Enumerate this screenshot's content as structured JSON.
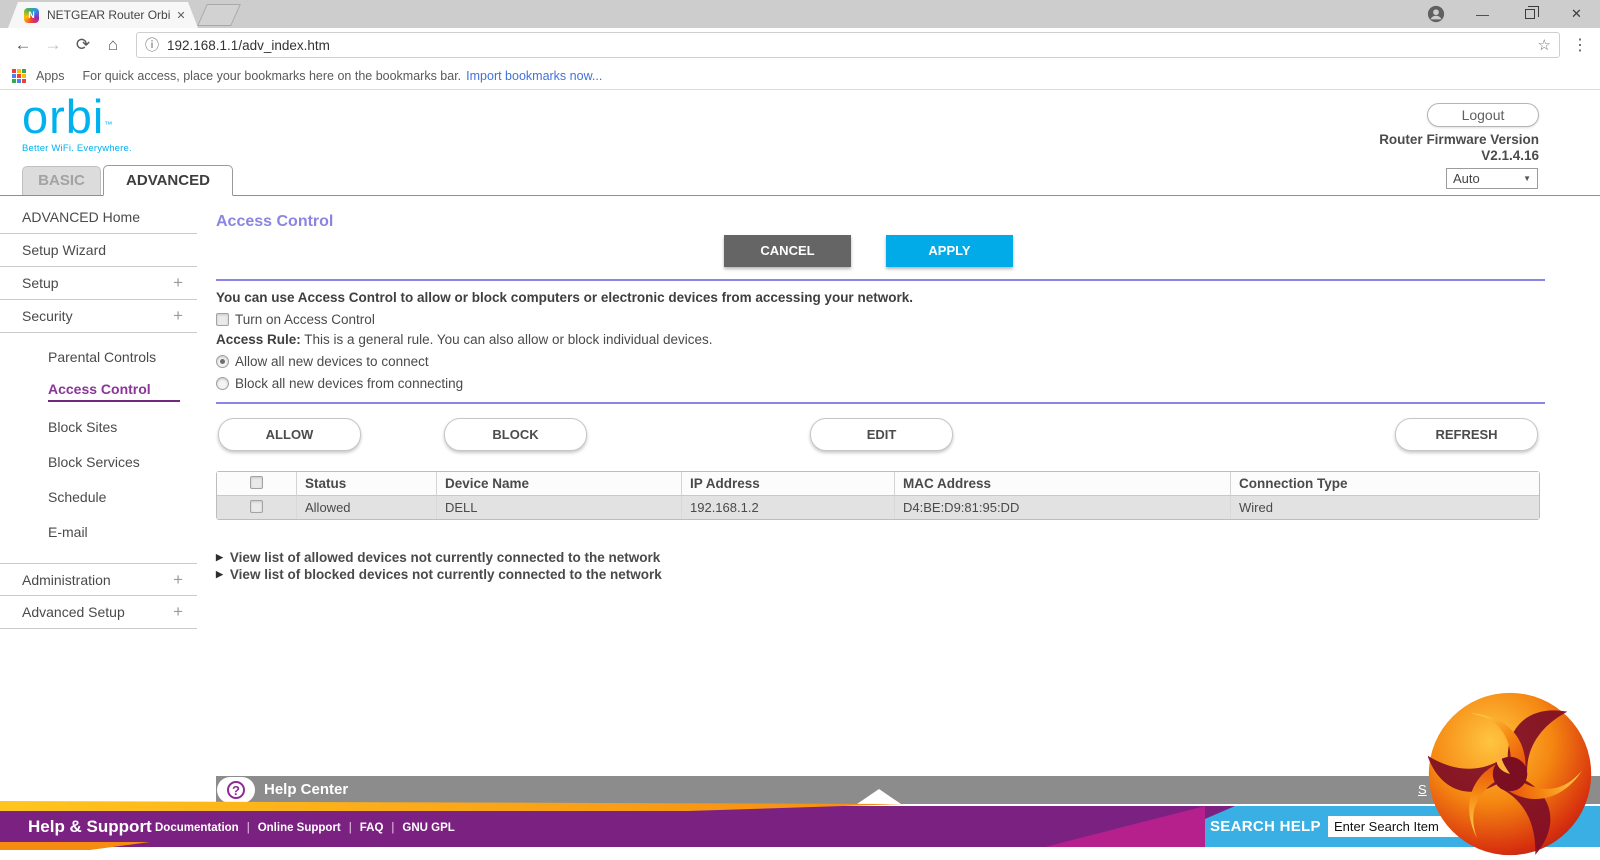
{
  "browser": {
    "tab_title": "NETGEAR Router Orbi",
    "favicon_letter": "N",
    "url": "192.168.1.1/adv_index.htm",
    "bookmarks_label": "Apps",
    "bookmarks_hint": "For quick access, place your bookmarks here on the bookmarks bar.",
    "bookmarks_link": "Import bookmarks now...",
    "icons": {
      "back": "←",
      "forward": "→",
      "reload": "⟳",
      "home": "⌂",
      "info": "ⓘ",
      "star": "☆",
      "menu": "⋮",
      "minimize": "—",
      "close": "✕",
      "tab_close": "✕"
    }
  },
  "header": {
    "logo_text": "orbi",
    "logo_tm": "™",
    "tagline": "Better WiFi. Everywhere.",
    "logout_label": "Logout",
    "firmware_label": "Router Firmware Version",
    "firmware_version": "V2.1.4.16",
    "language_selected": "Auto",
    "caret": "▼"
  },
  "tabs": {
    "basic": "BASIC",
    "advanced": "ADVANCED"
  },
  "sidebar": {
    "expand_icon": "+",
    "items": [
      {
        "label": "ADVANCED Home"
      },
      {
        "label": "Setup Wizard"
      },
      {
        "label": "Setup"
      },
      {
        "label": "Security"
      }
    ],
    "security_submenu": [
      {
        "label": "Parental Controls"
      },
      {
        "label": "Access Control"
      },
      {
        "label": "Block Sites"
      },
      {
        "label": "Block Services"
      },
      {
        "label": "Schedule"
      },
      {
        "label": "E-mail"
      }
    ],
    "bottom_items": [
      {
        "label": "Administration"
      },
      {
        "label": "Advanced Setup"
      }
    ]
  },
  "main": {
    "title": "Access Control",
    "cancel_label": "CANCEL",
    "apply_label": "APPLY",
    "intro": "You can use Access Control to allow or block computers or electronic devices from accessing your network.",
    "turn_on_label": "Turn on Access Control",
    "access_rule_label": "Access Rule:",
    "access_rule_text": " This is a general rule. You can also allow or block individual devices.",
    "radio_allow": "Allow all new devices to connect",
    "radio_block": "Block all new devices from connecting",
    "buttons": {
      "allow": "ALLOW",
      "block": "BLOCK",
      "edit": "EDIT",
      "refresh": "REFRESH"
    },
    "table": {
      "headers": [
        "Status",
        "Device Name",
        "IP Address",
        "MAC Address",
        "Connection Type"
      ],
      "rows": [
        {
          "status": "Allowed",
          "device": "DELL",
          "ip": "192.168.1.2",
          "mac": "D4:BE:D9:81:95:DD",
          "connection": "Wired"
        }
      ]
    },
    "link_arrow": "▶",
    "links": [
      "View list of allowed devices not currently connected to the network",
      "View list of blocked devices not currently connected to the network"
    ]
  },
  "help": {
    "help_center": "Help Center",
    "question_glyph": "?",
    "show_hide_partial": "S",
    "help_support": "Help & Support",
    "footer_links": [
      "Documentation",
      "Online Support",
      "FAQ",
      "GNU GPL"
    ],
    "separator": "|",
    "search_label": "SEARCH HELP",
    "search_value": "Enter Search Item"
  },
  "colors": {
    "orbi_cyan": "#00b1ef",
    "apply_blue": "#00abe8",
    "cancel_gray": "#666565",
    "rule_purple": "#8b85e6",
    "active_nav_purple": "#8b3598",
    "allowed_green": "#2e9b2e",
    "helpbar_gray": "#8c8c8c",
    "footer_purple": "#7b2181",
    "footer_orange": "#f68b12",
    "footer_magenta": "#b5208d",
    "footer_blue": "#3aafe4"
  }
}
